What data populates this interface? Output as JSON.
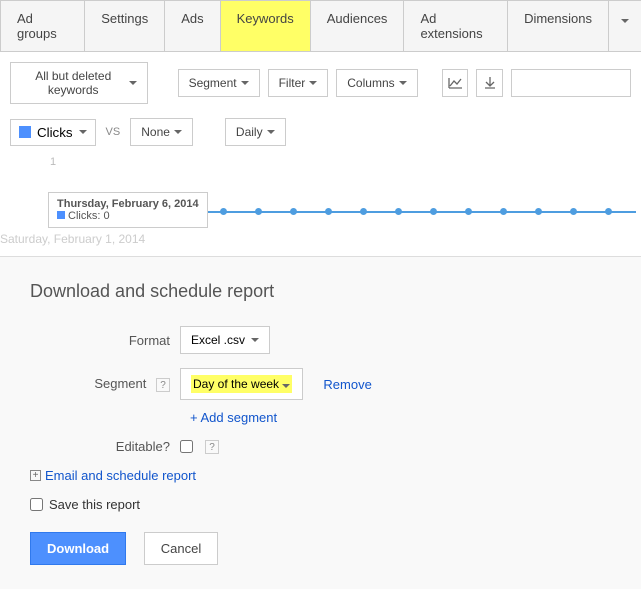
{
  "tabs": {
    "t0": "Ad groups",
    "t1": "Settings",
    "t2": "Ads",
    "t3": "Keywords",
    "t4": "Audiences",
    "t5": "Ad extensions",
    "t6": "Dimensions",
    "more": "▾"
  },
  "toolbar": {
    "filter_kw": "All but deleted keywords",
    "segment": "Segment",
    "filter": "Filter",
    "columns": "Columns"
  },
  "metric": {
    "clicks": "Clicks",
    "vs": "VS",
    "none": "None",
    "daily": "Daily"
  },
  "chart_data": {
    "type": "line",
    "y_tick": "1",
    "tooltip_date": "Thursday, February 6, 2014",
    "tooltip_metric": "Clicks: 0",
    "x_start_label": "Saturday, February 1, 2014",
    "values": [
      0,
      0,
      0,
      0,
      0,
      0,
      0,
      0,
      0,
      0,
      0,
      0,
      0,
      0,
      0,
      0
    ]
  },
  "dialog": {
    "title": "Download and schedule report",
    "format_label": "Format",
    "format_value": "Excel .csv",
    "segment_label": "Segment",
    "segment_value": "Day of the week",
    "remove": "Remove",
    "add_segment": "+ Add segment",
    "editable_label": "Editable?",
    "email_schedule": "Email and schedule report",
    "save_report": "Save this report",
    "download": "Download",
    "cancel": "Cancel"
  }
}
